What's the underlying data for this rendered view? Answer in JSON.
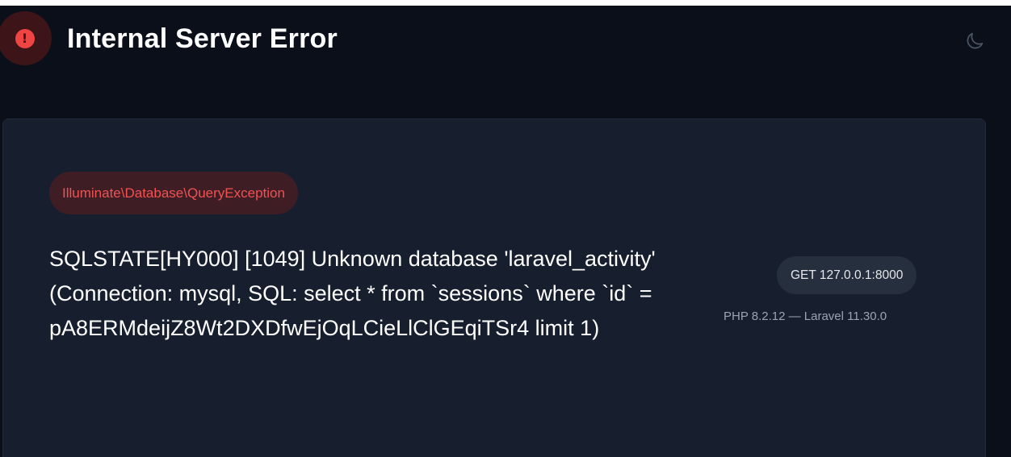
{
  "header": {
    "title": "Internal Server Error",
    "error_icon_glyph": "!",
    "theme_toggle_icon": "moon-icon"
  },
  "error": {
    "exception_class": "Illuminate\\Database\\QueryException",
    "message": "SQLSTATE[HY000] [1049] Unknown database 'laravel_activity' (Connection: mysql, SQL: select * from `sessions` where `id` = pA8ERMdeijZ8Wt2DXDfwEjOqLCieLlClGEqiTSr4 limit 1)",
    "request": "GET 127.0.0.1:8000",
    "versions": "PHP 8.2.12 — Laravel 11.30.0"
  },
  "colors": {
    "background": "#0b0f1a",
    "card": "#171f2f",
    "error_red": "#ef4444",
    "pill_red_bg": "#3f1d25"
  }
}
